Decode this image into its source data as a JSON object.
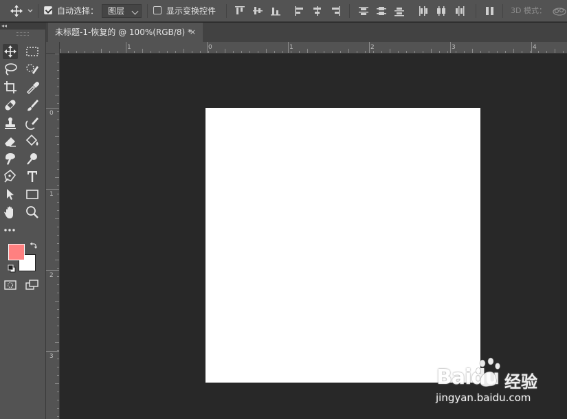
{
  "options_bar": {
    "move_tool_icon": "move-icon",
    "auto_select_label": "自动选择：",
    "auto_select_checked": true,
    "layer_select_value": "图层",
    "show_transform_label": "显示变换控件",
    "show_transform_checked": false,
    "mode_3d_label": "3D 模式："
  },
  "document_tab": {
    "title": "未标题-1-恢复的 @ 100%(RGB/8) *",
    "close_symbol": "×"
  },
  "ruler": {
    "top_labels": [
      "1",
      "0",
      "1",
      "2",
      "3",
      "4"
    ],
    "left_labels": [
      "0",
      "1",
      "2",
      "3"
    ]
  },
  "tools": [
    {
      "name": "move-tool",
      "icon": "move-icon"
    },
    {
      "name": "marquee-tool",
      "icon": "marquee-icon"
    },
    {
      "name": "lasso-tool",
      "icon": "lasso-icon"
    },
    {
      "name": "quick-select-tool",
      "icon": "quick-select-icon"
    },
    {
      "name": "crop-tool",
      "icon": "crop-icon"
    },
    {
      "name": "eyedropper-tool",
      "icon": "eyedropper-icon"
    },
    {
      "name": "healing-tool",
      "icon": "bandage-icon"
    },
    {
      "name": "brush-tool",
      "icon": "brush-icon"
    },
    {
      "name": "stamp-tool",
      "icon": "stamp-icon"
    },
    {
      "name": "history-brush-tool",
      "icon": "history-brush-icon"
    },
    {
      "name": "eraser-tool",
      "icon": "eraser-icon"
    },
    {
      "name": "paint-bucket-tool",
      "icon": "bucket-icon"
    },
    {
      "name": "blur-tool",
      "icon": "smudge-icon"
    },
    {
      "name": "dodge-tool",
      "icon": "dodge-icon"
    },
    {
      "name": "pen-tool",
      "icon": "pen-icon"
    },
    {
      "name": "type-tool",
      "icon": "type-icon"
    },
    {
      "name": "path-select-tool",
      "icon": "arrow-icon"
    },
    {
      "name": "shape-tool",
      "icon": "rectangle-icon"
    },
    {
      "name": "hand-tool",
      "icon": "hand-icon"
    },
    {
      "name": "zoom-tool",
      "icon": "zoom-icon"
    },
    {
      "name": "more-tools",
      "icon": "ellipsis-icon"
    }
  ],
  "colors": {
    "foreground": "#ff8080",
    "background": "#ffffff",
    "panel": "#535353",
    "workspace": "#282828"
  },
  "watermark": {
    "brand": "Baidu",
    "brand_cn": "经验",
    "url": "jingyan.baidu.com"
  }
}
